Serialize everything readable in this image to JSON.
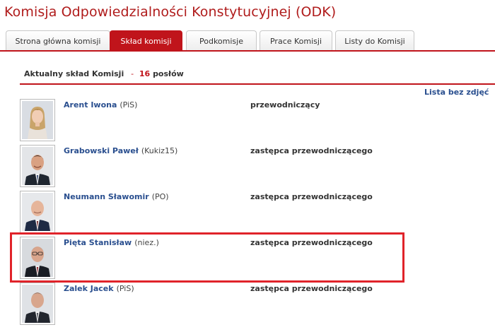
{
  "page": {
    "title": "Komisja Odpowiedzialności Konstytucyjnej (ODK)"
  },
  "tabs": [
    {
      "label": "Strona główna komisji",
      "active": false
    },
    {
      "label": "Skład komisji",
      "active": true
    },
    {
      "label": "Podkomisje",
      "active": false
    },
    {
      "label": "Prace Komisji",
      "active": false
    },
    {
      "label": "Listy do Komisji",
      "active": false
    }
  ],
  "section": {
    "heading": "Aktualny skład Komisji",
    "dash": "-",
    "count": "16",
    "count_unit": "posłów",
    "list_link": "Lista bez zdjęć"
  },
  "members": [
    {
      "name": "Arent Iwona",
      "party": "(PiS)",
      "role": "przewodniczący"
    },
    {
      "name": "Grabowski Paweł",
      "party": "(Kukiz15)",
      "role": "zastępca przewodniczącego"
    },
    {
      "name": "Neumann Sławomir",
      "party": "(PO)",
      "role": "zastępca przewodniczącego"
    },
    {
      "name": "Pięta Stanisław",
      "party": "(niez.)",
      "role": "zastępca przewodniczącego"
    },
    {
      "name": "Zalek Jacek",
      "party": "(PiS)",
      "role": "zastępca przewodniczącego"
    }
  ],
  "colors": {
    "accent": "#c0141b",
    "link": "#2a4f8f",
    "highlight": "#e0232a"
  }
}
